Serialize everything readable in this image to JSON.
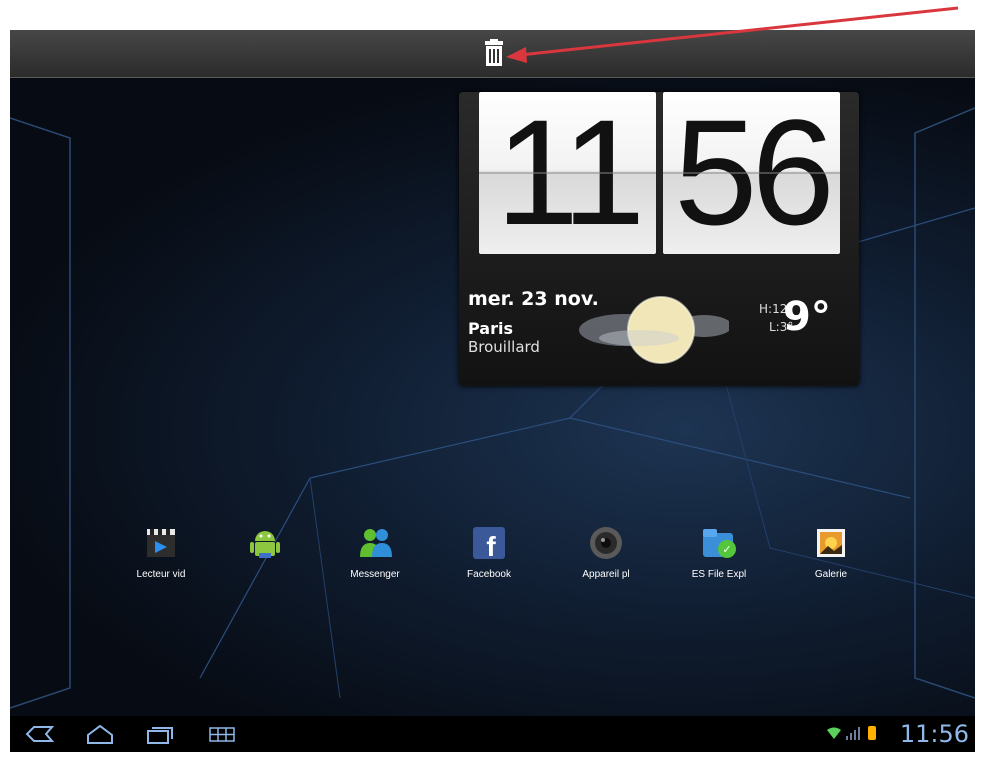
{
  "clock": {
    "hours": "11",
    "minutes": "56"
  },
  "weather": {
    "date": "mer. 23 nov.",
    "city": "Paris",
    "condition": "Brouillard",
    "high": "H:12°",
    "low": "L:3°",
    "temp": "9°"
  },
  "apps": [
    {
      "label": "Lecteur vid",
      "icon": "clapperboard-icon"
    },
    {
      "label": "",
      "icon": "android-icon"
    },
    {
      "label": "Messenger",
      "icon": "messenger-icon"
    },
    {
      "label": "Facebook",
      "icon": "facebook-icon"
    },
    {
      "label": "Appareil pl",
      "icon": "camera-icon"
    },
    {
      "label": "ES File Expl",
      "icon": "file-explorer-icon"
    },
    {
      "label": "Galerie",
      "icon": "gallery-icon"
    }
  ],
  "status": {
    "time": "11:56"
  },
  "colors": {
    "accent_arrow": "#d9363e",
    "status_text": "#8fb7e8",
    "battery": "#ffb300",
    "wifi": "#5ad25a"
  }
}
